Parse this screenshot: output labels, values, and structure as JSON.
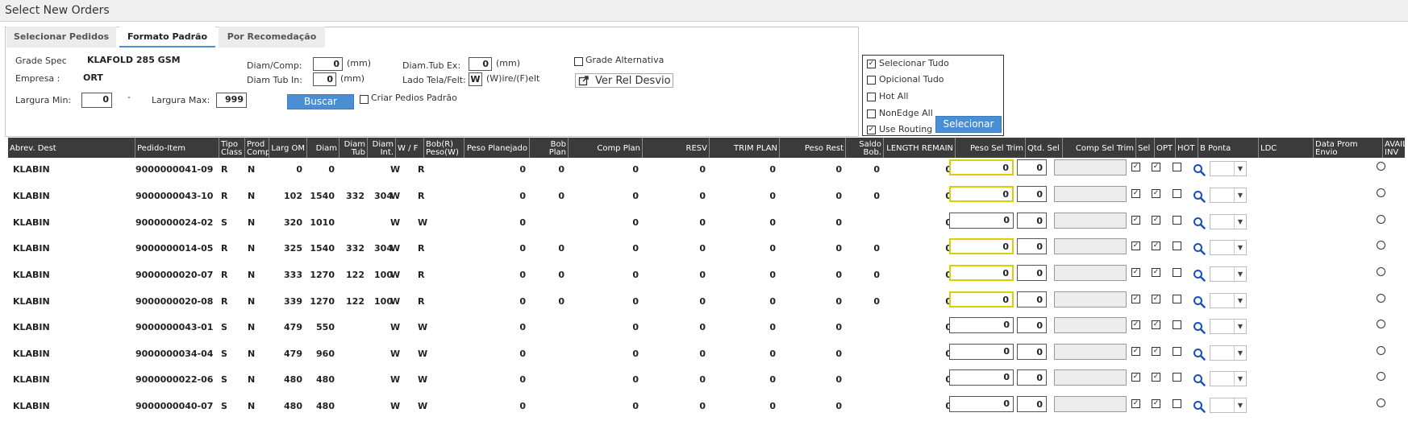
{
  "window": {
    "title": "Select New Orders"
  },
  "tabs": [
    {
      "label": "Selecionar Pedidos"
    },
    {
      "label": "Formato Padrão"
    },
    {
      "label": "Por Recomedação"
    }
  ],
  "filters": {
    "grade_spec_label": "Grade Spec",
    "grade_spec_value": "KLAFOLD 285 GSM",
    "empresa_label": "Empresa :",
    "empresa_value": "ORT",
    "largura_min_label": "Largura Min:",
    "largura_min_value": "0",
    "range_dash": "-",
    "largura_max_label": "Largura Max:",
    "largura_max_value": "999",
    "diam_comp_label": "Diam/Comp:",
    "diam_comp_value": "0",
    "diam_comp_unit": "(mm)",
    "diam_tub_in_label": "Diam Tub In:",
    "diam_tub_in_value": "0",
    "diam_tub_in_unit": "(mm)",
    "diam_tub_ex_label": "Diam.Tub Ex:",
    "diam_tub_ex_value": "0",
    "diam_tub_ex_unit": "(mm)",
    "lado_tela_label": "Lado Tela/Felt:",
    "lado_tela_value": "W",
    "lado_tela_hint": "(W)ire/(F)elt",
    "grade_alternativa_label": "Grade Alternativa",
    "grade_alternativa_checked": false,
    "ver_rel_desvio_label": "Ver Rel Desvio",
    "buscar_label": "Buscar",
    "criar_pedidos_label": "Criar Pedios Padrão",
    "criar_pedidos_checked": false
  },
  "selection": {
    "options": [
      {
        "label": "Selecionar Tudo",
        "checked": true
      },
      {
        "label": "Opicional Tudo",
        "checked": false
      },
      {
        "label": "Hot All",
        "checked": false
      },
      {
        "label": "NonEdge All",
        "checked": false
      },
      {
        "label": "Use Routing",
        "checked": true
      }
    ],
    "button_label": "Selecionar"
  },
  "table": {
    "columns": [
      "Abrev. Dest",
      "Pedido-Item",
      "Tipo Class",
      "Prod Comp",
      "Larg OM",
      "Diam",
      "Diam Tub",
      "Diam Int.",
      "W / F",
      "Bob(R) Peso(W)",
      "Peso Planejado",
      "Bob Plan",
      "Comp Plan",
      "RESV",
      "TRIM PLAN",
      "Peso Rest",
      "Saldo Bob.",
      "LENGTH REMAIN",
      "Peso Sel Trim",
      "Qtd. Sel",
      "Comp Sel Trim",
      "Sel",
      "OPT",
      "HOT",
      "B Ponta",
      "LDC",
      "Data Prom Envio",
      "AVAIL INV"
    ],
    "rows": [
      {
        "dest": "KLABIN",
        "pedido": "9000000041-09",
        "tipo": "R",
        "prod": "N",
        "larg": "0",
        "diam": "0",
        "diam_tub": "",
        "diam_int": "",
        "wf": "W",
        "bob": "R",
        "peso_plan": "0",
        "bob_plan": "0",
        "comp_plan": "0",
        "resv": "0",
        "trim_plan": "0",
        "peso_rest": "0",
        "saldo": "0",
        "length": "0",
        "peso_sel": "0",
        "qtd_sel": "0",
        "comp_sel": "",
        "sel": true,
        "opt": true,
        "hot": false,
        "trim_highlight": true
      },
      {
        "dest": "KLABIN",
        "pedido": "9000000043-10",
        "tipo": "R",
        "prod": "N",
        "larg": "102",
        "diam": "1540",
        "diam_tub": "332",
        "diam_int": "304",
        "wf": "W",
        "bob": "R",
        "peso_plan": "0",
        "bob_plan": "0",
        "comp_plan": "0",
        "resv": "0",
        "trim_plan": "0",
        "peso_rest": "0",
        "saldo": "0",
        "length": "0",
        "peso_sel": "0",
        "qtd_sel": "0",
        "comp_sel": "",
        "sel": true,
        "opt": true,
        "hot": false,
        "trim_highlight": true
      },
      {
        "dest": "KLABIN",
        "pedido": "9000000024-02",
        "tipo": "S",
        "prod": "N",
        "larg": "320",
        "diam": "1010",
        "diam_tub": "",
        "diam_int": "",
        "wf": "W",
        "bob": "W",
        "peso_plan": "0",
        "bob_plan": "",
        "comp_plan": "0",
        "resv": "0",
        "trim_plan": "0",
        "peso_rest": "0",
        "saldo": "",
        "length": "0",
        "peso_sel": "0",
        "qtd_sel": "0",
        "comp_sel": "",
        "sel": true,
        "opt": true,
        "hot": false,
        "trim_highlight": false
      },
      {
        "dest": "KLABIN",
        "pedido": "9000000014-05",
        "tipo": "R",
        "prod": "N",
        "larg": "325",
        "diam": "1540",
        "diam_tub": "332",
        "diam_int": "304",
        "wf": "W",
        "bob": "R",
        "peso_plan": "0",
        "bob_plan": "0",
        "comp_plan": "0",
        "resv": "0",
        "trim_plan": "0",
        "peso_rest": "0",
        "saldo": "0",
        "length": "0",
        "peso_sel": "0",
        "qtd_sel": "0",
        "comp_sel": "",
        "sel": true,
        "opt": true,
        "hot": false,
        "trim_highlight": true
      },
      {
        "dest": "KLABIN",
        "pedido": "9000000020-07",
        "tipo": "R",
        "prod": "N",
        "larg": "333",
        "diam": "1270",
        "diam_tub": "122",
        "diam_int": "100",
        "wf": "W",
        "bob": "R",
        "peso_plan": "0",
        "bob_plan": "0",
        "comp_plan": "0",
        "resv": "0",
        "trim_plan": "0",
        "peso_rest": "0",
        "saldo": "0",
        "length": "0",
        "peso_sel": "0",
        "qtd_sel": "0",
        "comp_sel": "",
        "sel": true,
        "opt": true,
        "hot": false,
        "trim_highlight": true
      },
      {
        "dest": "KLABIN",
        "pedido": "9000000020-08",
        "tipo": "R",
        "prod": "N",
        "larg": "339",
        "diam": "1270",
        "diam_tub": "122",
        "diam_int": "100",
        "wf": "W",
        "bob": "R",
        "peso_plan": "0",
        "bob_plan": "0",
        "comp_plan": "0",
        "resv": "0",
        "trim_plan": "0",
        "peso_rest": "0",
        "saldo": "0",
        "length": "0",
        "peso_sel": "0",
        "qtd_sel": "0",
        "comp_sel": "",
        "sel": true,
        "opt": true,
        "hot": false,
        "trim_highlight": true
      },
      {
        "dest": "KLABIN",
        "pedido": "9000000043-01",
        "tipo": "S",
        "prod": "N",
        "larg": "479",
        "diam": "550",
        "diam_tub": "",
        "diam_int": "",
        "wf": "W",
        "bob": "W",
        "peso_plan": "0",
        "bob_plan": "",
        "comp_plan": "0",
        "resv": "0",
        "trim_plan": "0",
        "peso_rest": "0",
        "saldo": "",
        "length": "0",
        "peso_sel": "0",
        "qtd_sel": "0",
        "comp_sel": "",
        "sel": true,
        "opt": true,
        "hot": false,
        "trim_highlight": false
      },
      {
        "dest": "KLABIN",
        "pedido": "9000000034-04",
        "tipo": "S",
        "prod": "N",
        "larg": "479",
        "diam": "960",
        "diam_tub": "",
        "diam_int": "",
        "wf": "W",
        "bob": "W",
        "peso_plan": "0",
        "bob_plan": "",
        "comp_plan": "0",
        "resv": "0",
        "trim_plan": "0",
        "peso_rest": "0",
        "saldo": "",
        "length": "0",
        "peso_sel": "0",
        "qtd_sel": "0",
        "comp_sel": "",
        "sel": true,
        "opt": true,
        "hot": false,
        "trim_highlight": false
      },
      {
        "dest": "KLABIN",
        "pedido": "9000000022-06",
        "tipo": "S",
        "prod": "N",
        "larg": "480",
        "diam": "480",
        "diam_tub": "",
        "diam_int": "",
        "wf": "W",
        "bob": "W",
        "peso_plan": "0",
        "bob_plan": "",
        "comp_plan": "0",
        "resv": "0",
        "trim_plan": "0",
        "peso_rest": "0",
        "saldo": "",
        "length": "0",
        "peso_sel": "0",
        "qtd_sel": "0",
        "comp_sel": "",
        "sel": true,
        "opt": true,
        "hot": false,
        "trim_highlight": false
      },
      {
        "dest": "KLABIN",
        "pedido": "9000000040-07",
        "tipo": "S",
        "prod": "N",
        "larg": "480",
        "diam": "480",
        "diam_tub": "",
        "diam_int": "",
        "wf": "W",
        "bob": "W",
        "peso_plan": "0",
        "bob_plan": "",
        "comp_plan": "0",
        "resv": "0",
        "trim_plan": "0",
        "peso_rest": "0",
        "saldo": "",
        "length": "0",
        "peso_sel": "0",
        "qtd_sel": "0",
        "comp_sel": "",
        "sel": true,
        "opt": true,
        "hot": false,
        "trim_highlight": false
      }
    ]
  },
  "colors": {
    "accent": "#4a8fd4",
    "header_bg": "#3b3b3b",
    "trim_highlight": "#d8d000"
  }
}
